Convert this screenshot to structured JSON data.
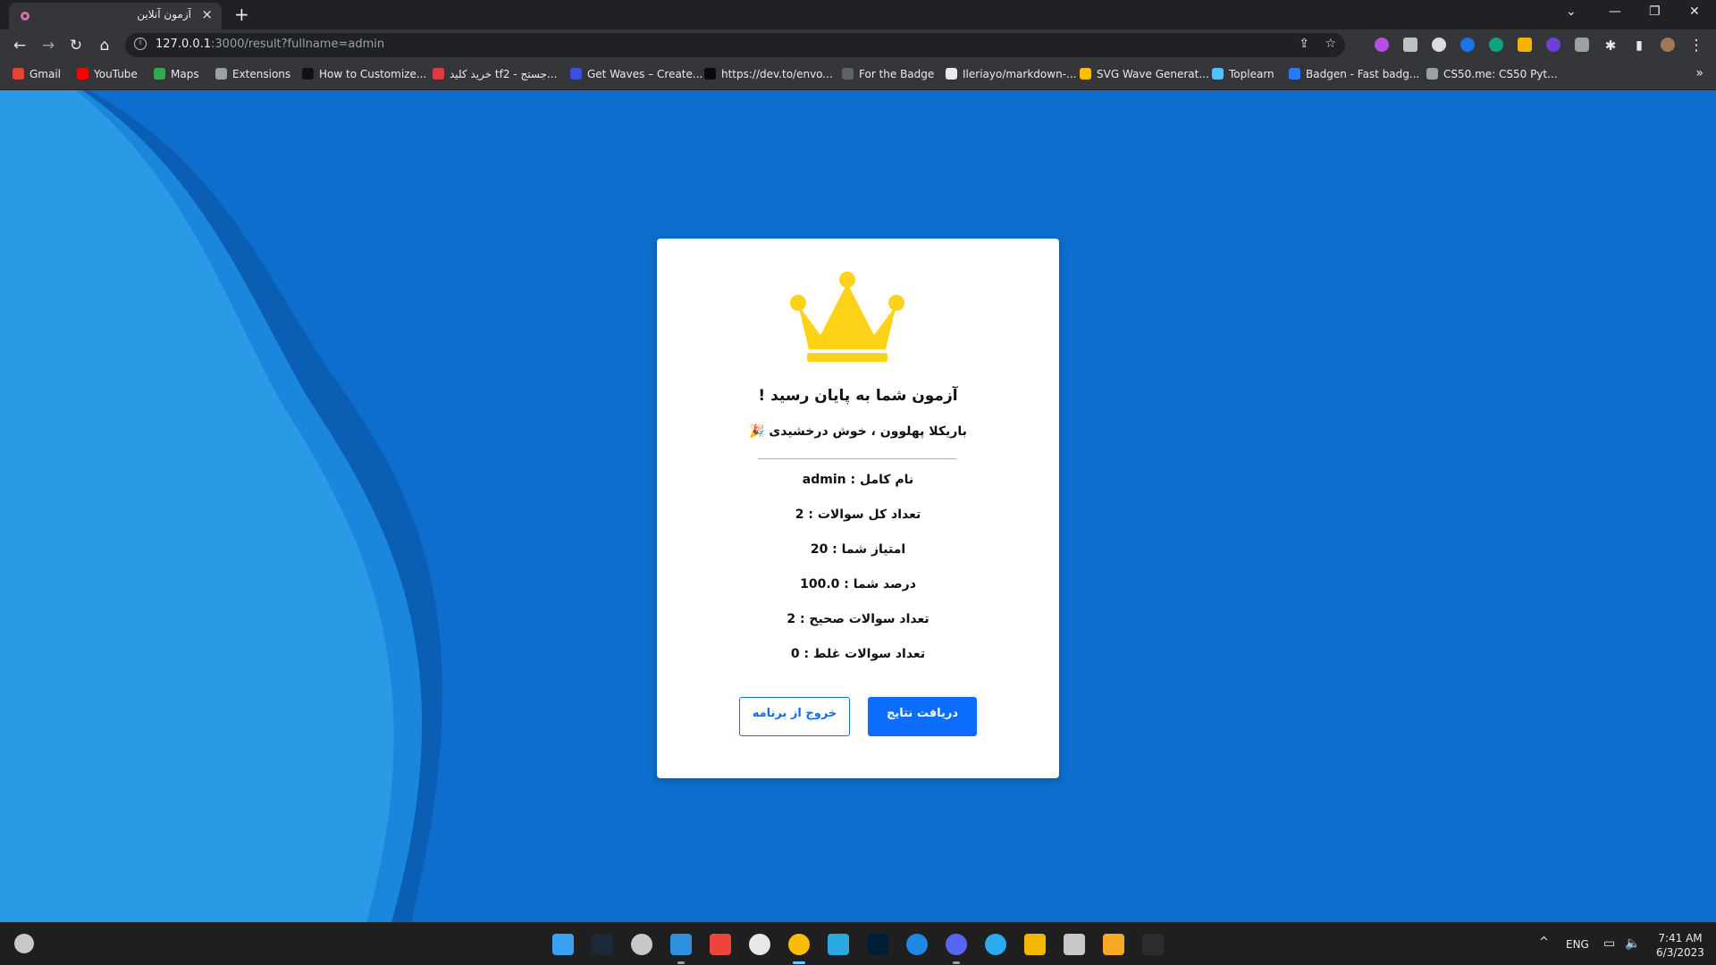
{
  "browser": {
    "tab": {
      "title": "آزمون آنلاین"
    },
    "address": {
      "host": "127.0.0.1",
      "path": ":3000/result?fullname=admin"
    },
    "bookmarks": [
      {
        "label": "Gmail",
        "color": "#ea4335"
      },
      {
        "label": "YouTube",
        "color": "#ff0000"
      },
      {
        "label": "Maps",
        "color": "#34a853"
      },
      {
        "label": "Extensions",
        "color": "#9aa0a6"
      },
      {
        "label": "How to Customize...",
        "color": "#111111"
      },
      {
        "label": "خرید کلید tf2 - جستج...",
        "color": "#e03a3e"
      },
      {
        "label": "Get Waves – Create...",
        "color": "#3552e0"
      },
      {
        "label": "https://dev.to/envo...",
        "color": "#0a0a0a"
      },
      {
        "label": "For the Badge",
        "color": "#5f6368"
      },
      {
        "label": "Ileriayo/markdown-...",
        "color": "#e8eaed"
      },
      {
        "label": "SVG Wave Generat...",
        "color": "#fbbc04"
      },
      {
        "label": "Toplearn",
        "color": "#4fc3f7"
      },
      {
        "label": "Badgen - Fast badg...",
        "color": "#2979ff"
      },
      {
        "label": "CS50.me: CS50 Pyt...",
        "color": "#9aa0a6"
      }
    ]
  },
  "result": {
    "title": "آزمون شما به پایان رسید !",
    "subtitle": "باریکلا پهلوون ، خوش درخشیدی 🎉",
    "stats": [
      "نام کامل : admin",
      "تعداد کل سوالات : 2",
      "امتیاز شما : 20",
      "درصد شما : 100.0",
      "تعداد سوالات صحیح : 2",
      "تعداد سوالات غلط : 0"
    ],
    "buttons": {
      "results": "دریافت نتایج",
      "exit": "خروج از برنامه"
    }
  },
  "taskbar": {
    "apps": [
      {
        "name": "start",
        "color": "#3aa0f3"
      },
      {
        "name": "steam",
        "color": "#1b2838"
      },
      {
        "name": "obs-like",
        "color": "#c8c8c8"
      },
      {
        "name": "vscode",
        "color": "#2f8fe0"
      },
      {
        "name": "anydesk",
        "color": "#ef443b"
      },
      {
        "name": "obs",
        "color": "#e8e8e8"
      },
      {
        "name": "chrome",
        "color": "#fbbc04"
      },
      {
        "name": "remote-desktop",
        "color": "#2aa9e0"
      },
      {
        "name": "photoshop",
        "color": "#001e36"
      },
      {
        "name": "app-store",
        "color": "#1e88e5"
      },
      {
        "name": "discord",
        "color": "#5865f2"
      },
      {
        "name": "telegram",
        "color": "#2aabee"
      },
      {
        "name": "vs-code-alt",
        "color": "#f5b800"
      },
      {
        "name": "network-tool",
        "color": "#c8c8c8"
      },
      {
        "name": "files",
        "color": "#f9a825"
      },
      {
        "name": "terminal",
        "color": "#2d2d2d"
      }
    ],
    "lang": "ENG",
    "time": "7:41 AM",
    "date": "6/3/2023"
  },
  "colors": {
    "page_bg": "#0d6ecd",
    "wave_light": "#2a9ae6",
    "crown": "#ffd21a",
    "primary": "#0d6efd"
  }
}
